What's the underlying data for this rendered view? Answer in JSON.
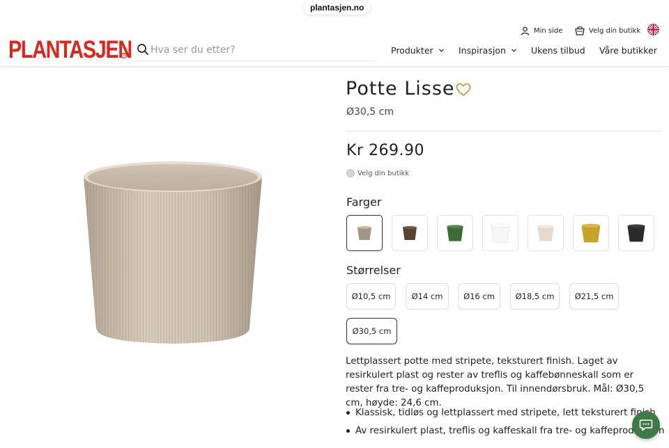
{
  "browser": {
    "url": "plantasjen.no"
  },
  "header": {
    "logo_text": "PLANTASJEN",
    "logo_registered": "®",
    "brand_color": "#e2231a",
    "search": {
      "placeholder": "Hva ser du etter?",
      "value": ""
    },
    "utility": {
      "my_page": "Min side",
      "choose_store": "Velg din butikk",
      "language_flag": "uk-flag-icon"
    },
    "nav": {
      "products": "Produkter",
      "inspiration": "Inspirasjon",
      "weekly_offers": "Ukens tilbud",
      "our_stores": "Våre butikker"
    }
  },
  "product": {
    "title": "Potte Lisse",
    "size_subtitle": "Ø30,5 cm",
    "price": "Kr 269.90",
    "store_label": "Velg din butikk",
    "colors_heading": "Farger",
    "colors": [
      {
        "name": "beige",
        "hex": "#a39585",
        "selected": true
      },
      {
        "name": "brown",
        "hex": "#5a4333",
        "selected": false
      },
      {
        "name": "green",
        "hex": "#3f6b36",
        "selected": false
      },
      {
        "name": "white",
        "hex": "#f6f6f6",
        "selected": false
      },
      {
        "name": "blush",
        "hex": "#e8d9cf",
        "selected": false
      },
      {
        "name": "mustard",
        "hex": "#c9a22a",
        "selected": false
      },
      {
        "name": "black",
        "hex": "#2a2a2a",
        "selected": false
      }
    ],
    "sizes_heading": "Størrelser",
    "sizes": [
      {
        "label": "Ø10,5 cm",
        "selected": false
      },
      {
        "label": "Ø14 cm",
        "selected": false
      },
      {
        "label": "Ø16 cm",
        "selected": false
      },
      {
        "label": "Ø18,5 cm",
        "selected": false
      },
      {
        "label": "Ø21,5 cm",
        "selected": false
      },
      {
        "label": "Ø30,5 cm",
        "selected": true
      }
    ],
    "description": "Lettplassert potte med stripete, teksturert finish. Laget av resirkulert plast og rester av treflis og kaffebønneskall som er rester fra tre- og kaffeproduksjon. Til innendørsbruk. Mål: Ø30,5 cm, høyde: 24,6 cm.",
    "bullets": [
      "Klassisk, tidløs og lettplassert med stripete, lett teksturert finish",
      "Av resirkulert plast, treflis og kaffeskall fra tre- og kaffeproduksjon"
    ]
  },
  "chat": {
    "icon": "chat-icon",
    "color": "#3f7a44"
  }
}
